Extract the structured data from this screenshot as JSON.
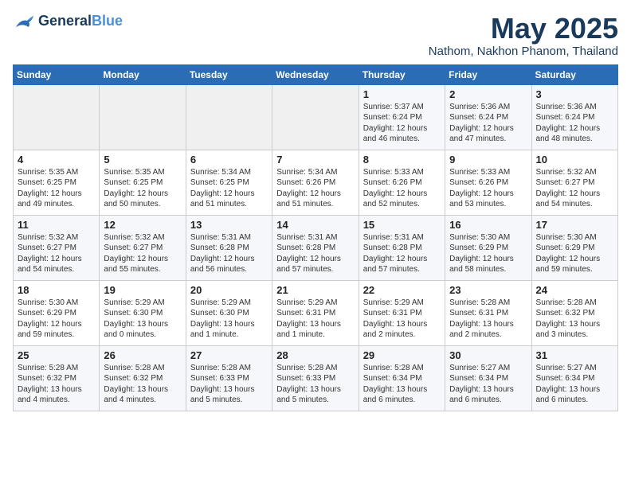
{
  "logo": {
    "line1": "General",
    "line2": "Blue"
  },
  "calendar": {
    "title": "May 2025",
    "subtitle": "Nathom, Nakhon Phanom, Thailand"
  },
  "headers": [
    "Sunday",
    "Monday",
    "Tuesday",
    "Wednesday",
    "Thursday",
    "Friday",
    "Saturday"
  ],
  "weeks": [
    [
      {
        "day": "",
        "info": ""
      },
      {
        "day": "",
        "info": ""
      },
      {
        "day": "",
        "info": ""
      },
      {
        "day": "",
        "info": ""
      },
      {
        "day": "1",
        "info": "Sunrise: 5:37 AM\nSunset: 6:24 PM\nDaylight: 12 hours\nand 46 minutes."
      },
      {
        "day": "2",
        "info": "Sunrise: 5:36 AM\nSunset: 6:24 PM\nDaylight: 12 hours\nand 47 minutes."
      },
      {
        "day": "3",
        "info": "Sunrise: 5:36 AM\nSunset: 6:24 PM\nDaylight: 12 hours\nand 48 minutes."
      }
    ],
    [
      {
        "day": "4",
        "info": "Sunrise: 5:35 AM\nSunset: 6:25 PM\nDaylight: 12 hours\nand 49 minutes."
      },
      {
        "day": "5",
        "info": "Sunrise: 5:35 AM\nSunset: 6:25 PM\nDaylight: 12 hours\nand 50 minutes."
      },
      {
        "day": "6",
        "info": "Sunrise: 5:34 AM\nSunset: 6:25 PM\nDaylight: 12 hours\nand 51 minutes."
      },
      {
        "day": "7",
        "info": "Sunrise: 5:34 AM\nSunset: 6:26 PM\nDaylight: 12 hours\nand 51 minutes."
      },
      {
        "day": "8",
        "info": "Sunrise: 5:33 AM\nSunset: 6:26 PM\nDaylight: 12 hours\nand 52 minutes."
      },
      {
        "day": "9",
        "info": "Sunrise: 5:33 AM\nSunset: 6:26 PM\nDaylight: 12 hours\nand 53 minutes."
      },
      {
        "day": "10",
        "info": "Sunrise: 5:32 AM\nSunset: 6:27 PM\nDaylight: 12 hours\nand 54 minutes."
      }
    ],
    [
      {
        "day": "11",
        "info": "Sunrise: 5:32 AM\nSunset: 6:27 PM\nDaylight: 12 hours\nand 54 minutes."
      },
      {
        "day": "12",
        "info": "Sunrise: 5:32 AM\nSunset: 6:27 PM\nDaylight: 12 hours\nand 55 minutes."
      },
      {
        "day": "13",
        "info": "Sunrise: 5:31 AM\nSunset: 6:28 PM\nDaylight: 12 hours\nand 56 minutes."
      },
      {
        "day": "14",
        "info": "Sunrise: 5:31 AM\nSunset: 6:28 PM\nDaylight: 12 hours\nand 57 minutes."
      },
      {
        "day": "15",
        "info": "Sunrise: 5:31 AM\nSunset: 6:28 PM\nDaylight: 12 hours\nand 57 minutes."
      },
      {
        "day": "16",
        "info": "Sunrise: 5:30 AM\nSunset: 6:29 PM\nDaylight: 12 hours\nand 58 minutes."
      },
      {
        "day": "17",
        "info": "Sunrise: 5:30 AM\nSunset: 6:29 PM\nDaylight: 12 hours\nand 59 minutes."
      }
    ],
    [
      {
        "day": "18",
        "info": "Sunrise: 5:30 AM\nSunset: 6:29 PM\nDaylight: 12 hours\nand 59 minutes."
      },
      {
        "day": "19",
        "info": "Sunrise: 5:29 AM\nSunset: 6:30 PM\nDaylight: 13 hours\nand 0 minutes."
      },
      {
        "day": "20",
        "info": "Sunrise: 5:29 AM\nSunset: 6:30 PM\nDaylight: 13 hours\nand 1 minute."
      },
      {
        "day": "21",
        "info": "Sunrise: 5:29 AM\nSunset: 6:31 PM\nDaylight: 13 hours\nand 1 minute."
      },
      {
        "day": "22",
        "info": "Sunrise: 5:29 AM\nSunset: 6:31 PM\nDaylight: 13 hours\nand 2 minutes."
      },
      {
        "day": "23",
        "info": "Sunrise: 5:28 AM\nSunset: 6:31 PM\nDaylight: 13 hours\nand 2 minutes."
      },
      {
        "day": "24",
        "info": "Sunrise: 5:28 AM\nSunset: 6:32 PM\nDaylight: 13 hours\nand 3 minutes."
      }
    ],
    [
      {
        "day": "25",
        "info": "Sunrise: 5:28 AM\nSunset: 6:32 PM\nDaylight: 13 hours\nand 4 minutes."
      },
      {
        "day": "26",
        "info": "Sunrise: 5:28 AM\nSunset: 6:32 PM\nDaylight: 13 hours\nand 4 minutes."
      },
      {
        "day": "27",
        "info": "Sunrise: 5:28 AM\nSunset: 6:33 PM\nDaylight: 13 hours\nand 5 minutes."
      },
      {
        "day": "28",
        "info": "Sunrise: 5:28 AM\nSunset: 6:33 PM\nDaylight: 13 hours\nand 5 minutes."
      },
      {
        "day": "29",
        "info": "Sunrise: 5:28 AM\nSunset: 6:34 PM\nDaylight: 13 hours\nand 6 minutes."
      },
      {
        "day": "30",
        "info": "Sunrise: 5:27 AM\nSunset: 6:34 PM\nDaylight: 13 hours\nand 6 minutes."
      },
      {
        "day": "31",
        "info": "Sunrise: 5:27 AM\nSunset: 6:34 PM\nDaylight: 13 hours\nand 6 minutes."
      }
    ]
  ]
}
